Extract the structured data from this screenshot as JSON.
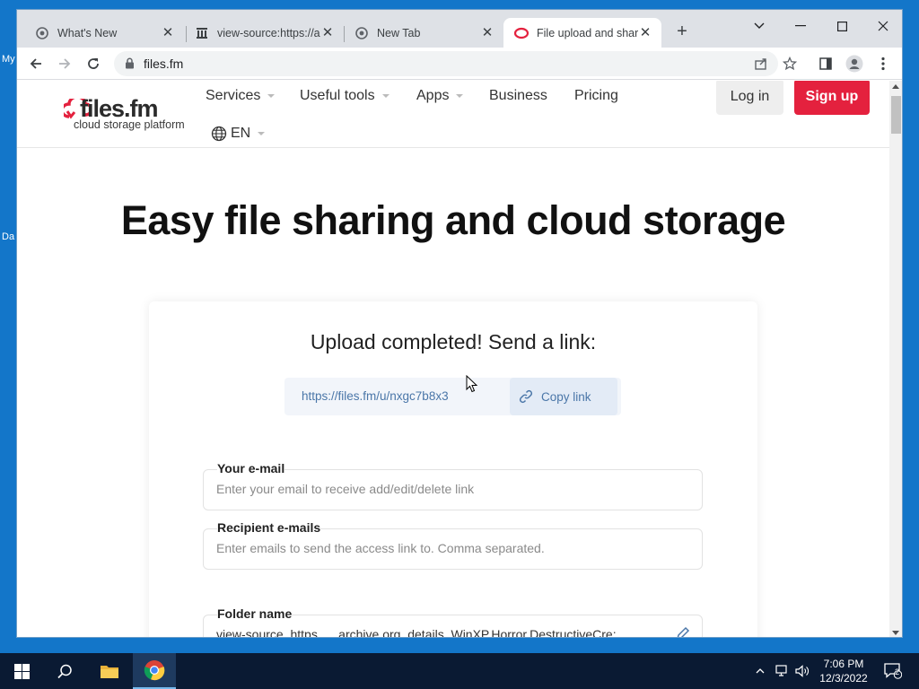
{
  "desktop": {
    "fragments": [
      "My",
      "Da"
    ]
  },
  "browser": {
    "tabs": [
      {
        "title": "What's New",
        "favicon": "chrome-icon",
        "active": false
      },
      {
        "title": "view-source:https://a",
        "favicon": "archive-icon",
        "active": false
      },
      {
        "title": "New Tab",
        "favicon": "chrome-icon",
        "active": false
      },
      {
        "title": "File upload and shari",
        "favicon": "filesfm-icon",
        "active": true
      }
    ],
    "new_tab_label": "+",
    "address": "files.fm"
  },
  "site": {
    "logo_name": "files.fm",
    "logo_tagline": "cloud storage platform",
    "nav": [
      {
        "label": "Services",
        "dropdown": true
      },
      {
        "label": "Useful tools",
        "dropdown": true
      },
      {
        "label": "Apps",
        "dropdown": true
      },
      {
        "label": "Business",
        "dropdown": false
      },
      {
        "label": "Pricing",
        "dropdown": false
      }
    ],
    "language": "EN",
    "login_label": "Log in",
    "signup_label": "Sign up",
    "accent": "#e4213e"
  },
  "main": {
    "headline": "Easy file sharing and cloud storage",
    "card_title": "Upload completed! Send a link:",
    "share_link": "https://files.fm/u/nxgc7b8x3",
    "copy_label": "Copy link",
    "email": {
      "label": "Your e-mail",
      "placeholder": "Enter your email to receive add/edit/delete link",
      "value": ""
    },
    "recipients": {
      "label": "Recipient e-mails",
      "placeholder": "Enter emails to send the access link to. Comma separated.",
      "value": ""
    },
    "folder": {
      "label": "Folder name",
      "value": "view-source_https___archive.org_details_WinXP.Horror.DestructiveCre:"
    }
  },
  "taskbar": {
    "time": "7:06 PM",
    "date": "12/3/2022",
    "notification_count": "2"
  }
}
